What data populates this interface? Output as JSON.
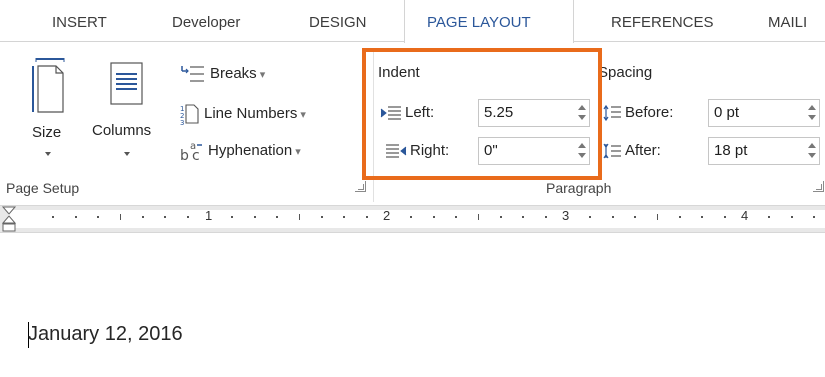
{
  "tabs": [
    {
      "label": "INSERT"
    },
    {
      "label": "Developer"
    },
    {
      "label": "DESIGN"
    },
    {
      "label": "PAGE LAYOUT",
      "active": true
    },
    {
      "label": "REFERENCES"
    },
    {
      "label": "MAILI"
    }
  ],
  "page_setup": {
    "size_label": "Size",
    "columns_label": "Columns",
    "breaks_label": "Breaks",
    "line_numbers_label": "Line Numbers",
    "hyphenation_label": "Hyphenation",
    "group_label": "Page Setup"
  },
  "paragraph": {
    "indent_heading": "Indent",
    "left_label": "Left:",
    "left_value": "5.25",
    "right_label": "Right:",
    "right_value": "0\"",
    "spacing_heading": "Spacing",
    "before_label": "Before:",
    "before_value": "0 pt",
    "after_label": "After:",
    "after_value": "18 pt",
    "group_label": "Paragraph"
  },
  "ruler": {
    "numbers": [
      "1",
      "2",
      "3",
      "4"
    ]
  },
  "document": {
    "text": "January 12, 2016"
  },
  "colors": {
    "accent": "#2b579a",
    "highlight": "#e96b1b"
  }
}
